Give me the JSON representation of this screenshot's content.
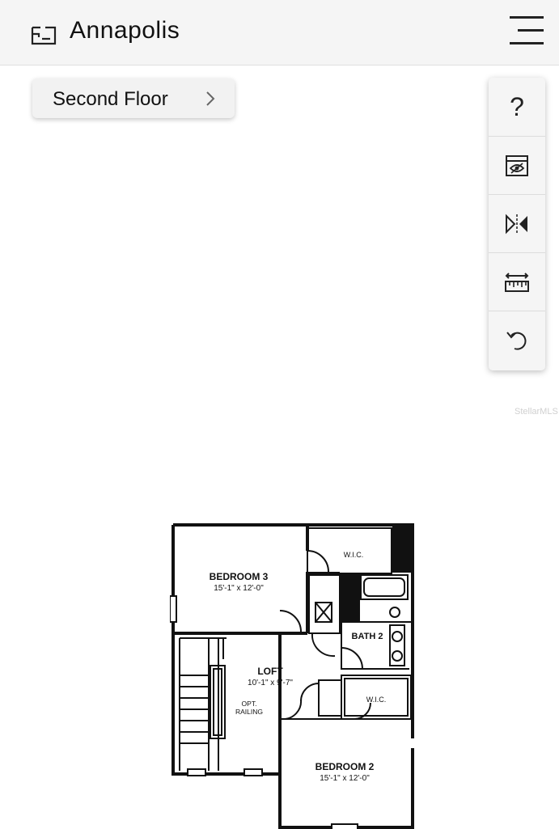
{
  "header": {
    "title": "Annapolis",
    "icon": "floorplan-icon",
    "menu_icon": "hamburger-menu-icon"
  },
  "floor_selector": {
    "label": "Second Floor",
    "icon": "chevron-right-icon"
  },
  "toolbar": {
    "items": [
      {
        "name": "help",
        "label": "?",
        "icon": "question-mark-icon"
      },
      {
        "name": "view-toggle",
        "icon": "eye-view-icon"
      },
      {
        "name": "mirror",
        "icon": "flip-horizontal-icon"
      },
      {
        "name": "measure",
        "icon": "ruler-icon"
      },
      {
        "name": "reset",
        "icon": "undo-icon"
      }
    ]
  },
  "watermark": "StellarMLS",
  "floorplan": {
    "bedroom3": {
      "name": "BEDROOM 3",
      "dims": "15'-1\" x 12'-0\""
    },
    "wic_top": {
      "name": "W.I.C."
    },
    "bath2": {
      "name": "BATH 2"
    },
    "loft": {
      "name": "LOFT",
      "dims": "10'-1\" x 9'-7\""
    },
    "opt_railing": {
      "line1": "OPT.",
      "line2": "RAILING"
    },
    "wic_bottom": {
      "name": "W.I.C."
    },
    "bedroom2": {
      "name": "BEDROOM 2",
      "dims": "15'-1\" x 12'-0\""
    }
  },
  "colors": {
    "header_bg": "#f5f5f5",
    "panel_bg": "#f2f2f2",
    "wall": "#111111"
  }
}
